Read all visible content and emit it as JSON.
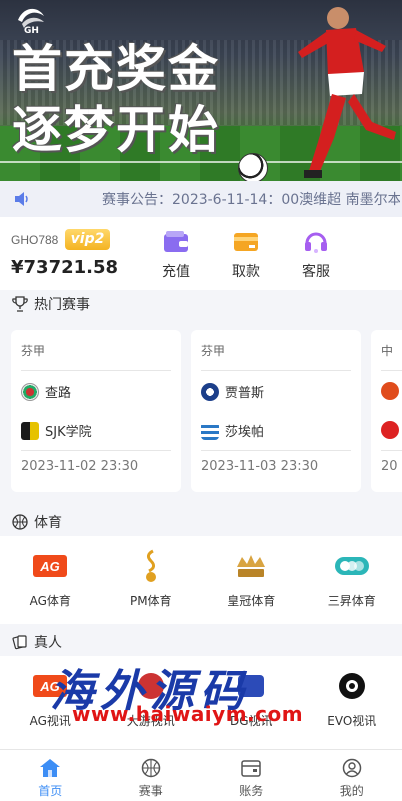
{
  "banner": {
    "logo_text": "GH",
    "headline_1": "首充奖金",
    "headline_2": "逐梦开始"
  },
  "notice": {
    "text": "赛事公告：2023-6-11-14：00澳维超 南墨尔本"
  },
  "account": {
    "username": "GHO788",
    "vip_badge": "vip2",
    "balance": "¥73721.58",
    "actions": [
      {
        "label": "充值",
        "icon": "wallet-icon",
        "color": "#8a6cf0"
      },
      {
        "label": "取款",
        "icon": "card-icon",
        "color": "#f5a623"
      },
      {
        "label": "客服",
        "icon": "headset-icon",
        "color": "#a65ef0"
      }
    ]
  },
  "hot_matches": {
    "title": "热门赛事",
    "matches": [
      {
        "league": "芬甲",
        "home": "查路",
        "away": "SJK学院",
        "date": "2023-11-02 23:30"
      },
      {
        "league": "芬甲",
        "home": "贾普斯",
        "away": "莎埃帕",
        "date": "2023-11-03 23:30"
      },
      {
        "league": "中",
        "home": "",
        "away": "",
        "date": "20"
      }
    ]
  },
  "sports": {
    "title": "体育",
    "items": [
      {
        "label": "AG体育",
        "icon": "ag-logo-icon"
      },
      {
        "label": "PM体育",
        "icon": "pm-logo-icon"
      },
      {
        "label": "皇冠体育",
        "icon": "crown-logo-icon"
      },
      {
        "label": "三昇体育",
        "icon": "sansheng-logo-icon"
      }
    ]
  },
  "live": {
    "title": "真人",
    "items": [
      {
        "label": "AG视讯",
        "icon": "ag-logo-icon"
      },
      {
        "label": "大游视讯",
        "icon": "dayou-logo-icon"
      },
      {
        "label": "DG视讯",
        "icon": "dg-logo-icon"
      },
      {
        "label": "EVO视讯",
        "icon": "evo-logo-icon"
      }
    ]
  },
  "watermark": {
    "line1": "海外源码",
    "line2": "www.haiwaiym.com"
  },
  "bottom_nav": [
    {
      "label": "首页",
      "icon": "home-icon",
      "active": true
    },
    {
      "label": "赛事",
      "icon": "ball-icon",
      "active": false
    },
    {
      "label": "账务",
      "icon": "wallet-icon",
      "active": false
    },
    {
      "label": "我的",
      "icon": "user-icon",
      "active": false
    }
  ],
  "colors": {
    "accent": "#3d8ef5",
    "vip_gold": "#f4b321",
    "background": "#f4f5f9"
  }
}
